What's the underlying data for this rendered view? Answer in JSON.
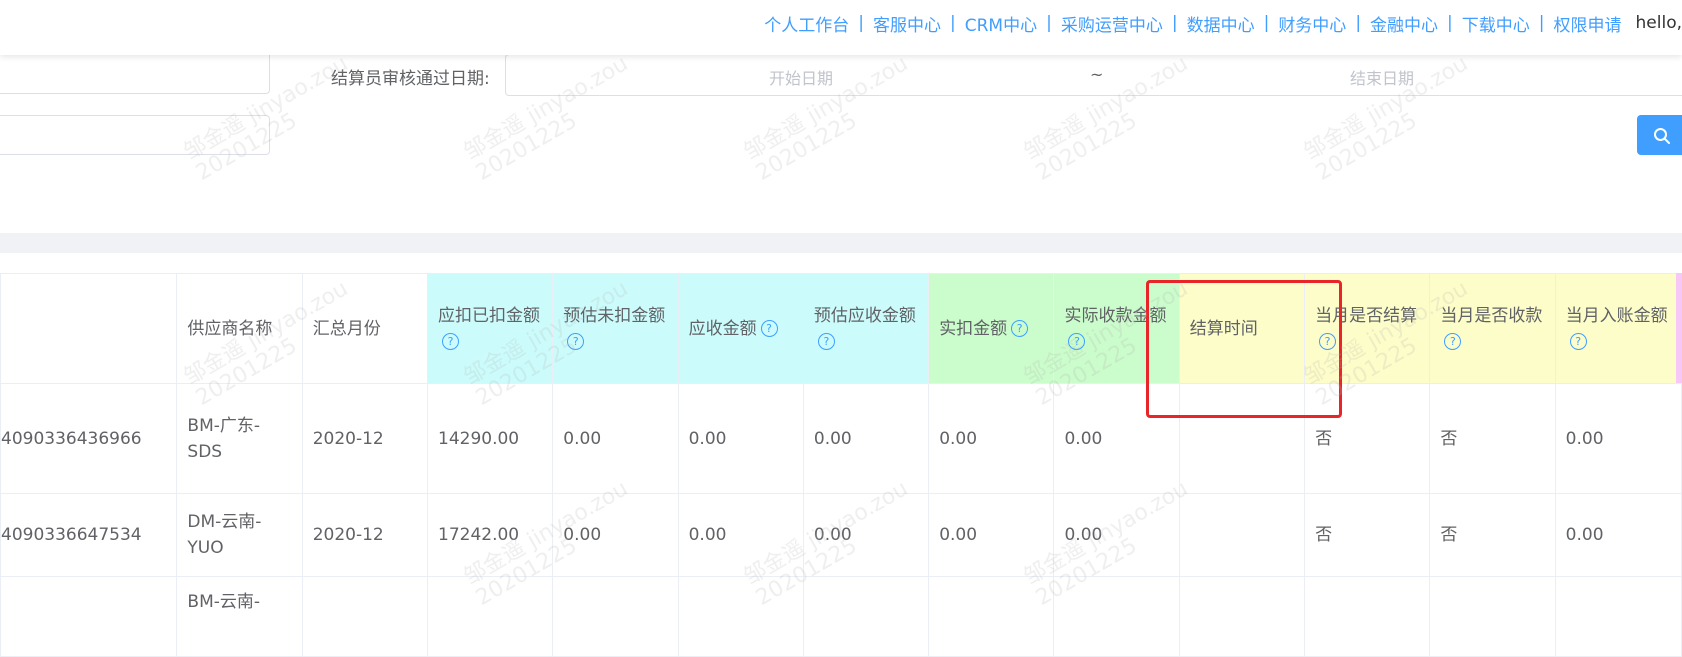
{
  "nav": {
    "items": [
      "个人工作台",
      "客服中心",
      "CRM中心",
      "采购运营中心",
      "数据中心",
      "财务中心",
      "金融中心",
      "下载中心",
      "权限申请"
    ],
    "separator": "|",
    "greeting": "hello,"
  },
  "filters": {
    "settle_audit_label": "结算员审核通过日期:",
    "start_placeholder": "开始日期",
    "range_sep": "~",
    "end_placeholder": "结束日期"
  },
  "table": {
    "headers": {
      "supplier": "供应商名称",
      "month": "汇总月份",
      "deducted": "应扣已扣金额",
      "est_undeducted": "预估未扣金额",
      "receivable": "应收金额",
      "est_receivable": "预估应收金额",
      "actual_deduct": "实扣金额",
      "actual_received": "实际收款金额",
      "settle_time": "结算时间",
      "month_settled": "当月是否结算",
      "month_received": "当月是否收款",
      "month_entry": "当月入账金额"
    },
    "help_glyph": "?",
    "rows": [
      {
        "id": "4090336436966",
        "supplier": "BM-广东-SDS",
        "month": "2020-12",
        "deducted": "14290.00",
        "est_undeducted": "0.00",
        "receivable": "0.00",
        "est_receivable": "0.00",
        "actual_deduct": "0.00",
        "actual_received": "0.00",
        "settle_time": "",
        "month_settled": "否",
        "month_received": "否",
        "month_entry": "0.00"
      },
      {
        "id": "4090336647534",
        "supplier": "DM-云南-YUO",
        "month": "2020-12",
        "deducted": "17242.00",
        "est_undeducted": "0.00",
        "receivable": "0.00",
        "est_receivable": "0.00",
        "actual_deduct": "0.00",
        "actual_received": "0.00",
        "settle_time": "",
        "month_settled": "否",
        "month_received": "否",
        "month_entry": "0.00"
      },
      {
        "id": "",
        "supplier": "BM-云南-",
        "month": "",
        "deducted": "",
        "est_undeducted": "",
        "receivable": "",
        "est_receivable": "",
        "actual_deduct": "",
        "actual_received": "",
        "settle_time": "",
        "month_settled": "",
        "month_received": "",
        "month_entry": ""
      }
    ]
  },
  "watermark": {
    "name": "邹金遥 jinyao.zou",
    "date": "20201225"
  },
  "colors": {
    "link": "#409eff",
    "cyan_header": "#ccfbfb",
    "green_header": "#cbfccb",
    "yellow_header": "#fdfdc9",
    "highlight_box": "#e8262a"
  }
}
